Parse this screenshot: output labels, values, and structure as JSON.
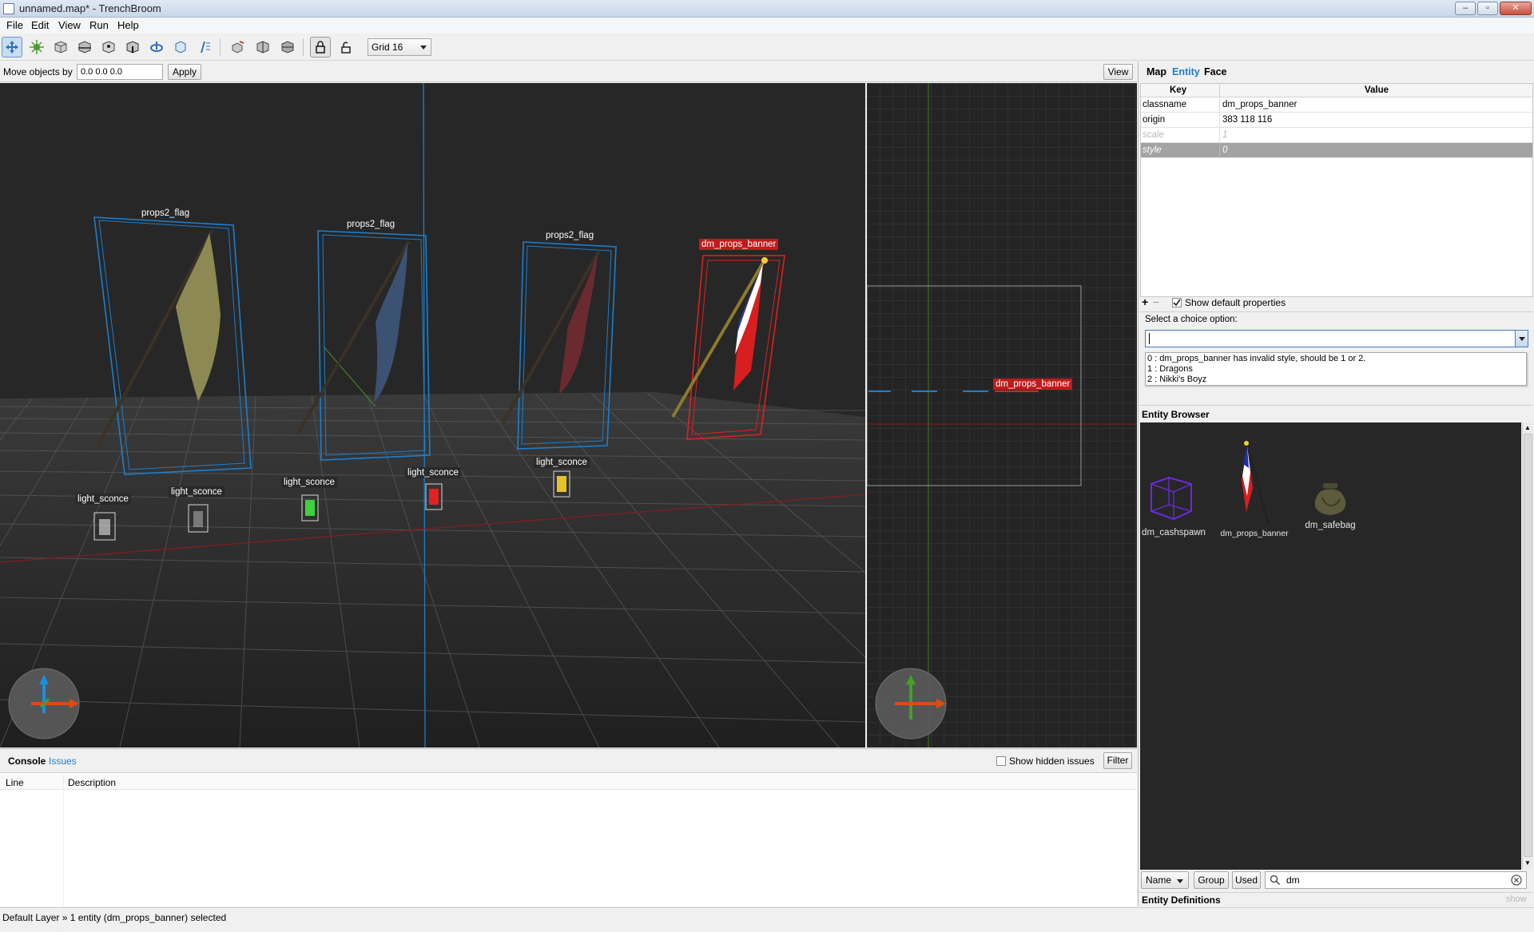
{
  "window": {
    "title": "unnamed.map* - TrenchBroom",
    "minimize": "–",
    "maximize": "▫",
    "close": "✕"
  },
  "menu": [
    "File",
    "Edit",
    "View",
    "Run",
    "Help"
  ],
  "toolbar": {
    "grid_select": "Grid 16"
  },
  "movebar": {
    "label": "Move objects by",
    "input_value": "0.0 0.0 0.0",
    "apply": "Apply",
    "view": "View"
  },
  "viewport3d": {
    "labels": {
      "flag1": "props2_flag",
      "flag2": "props2_flag",
      "flag3": "props2_flag",
      "banner": "dm_props_banner",
      "sconce1": "light_sconce",
      "sconce2": "light_sconce",
      "sconce3": "light_sconce",
      "sconce4": "light_sconce",
      "sconce5": "light_sconce"
    }
  },
  "viewport2d": {
    "banner_label": "dm_props_banner"
  },
  "inspector": {
    "tabs": {
      "map": "Map",
      "entity": "Entity",
      "face": "Face"
    },
    "headers": {
      "key": "Key",
      "value": "Value"
    },
    "properties": [
      {
        "key": "classname",
        "value": "dm_props_banner"
      },
      {
        "key": "origin",
        "value": "383 118 116"
      },
      {
        "key": "scale",
        "value": "1"
      },
      {
        "key": "style",
        "value": "0"
      }
    ],
    "add": "+",
    "remove": "−",
    "show_default": "Show default properties",
    "choice_label": "Select a choice option:",
    "choice_value": "",
    "choices": [
      "0 : dm_props_banner has invalid style, should be 1 or 2.",
      "1 : Dragons",
      "2 : Nikki's Boyz"
    ]
  },
  "entity_browser": {
    "title": "Entity Browser",
    "items": [
      "dm_cashspawn",
      "dm_props_banner",
      "dm_safebag"
    ],
    "sort_select": "Name",
    "group": "Group",
    "used": "Used",
    "search_value": "dm"
  },
  "entity_definitions": {
    "title": "Entity Definitions",
    "show": "show"
  },
  "console": {
    "tab_console": "Console",
    "tab_issues": "Issues",
    "show_hidden": "Show hidden issues",
    "filter": "Filter",
    "col_line": "Line",
    "col_description": "Description"
  },
  "status": "Default Layer » 1 entity (dm_props_banner) selected",
  "colors": {
    "selection": "#c01b1b",
    "accent_blue": "#1a7fd0",
    "viewport_bg": "#272727"
  }
}
